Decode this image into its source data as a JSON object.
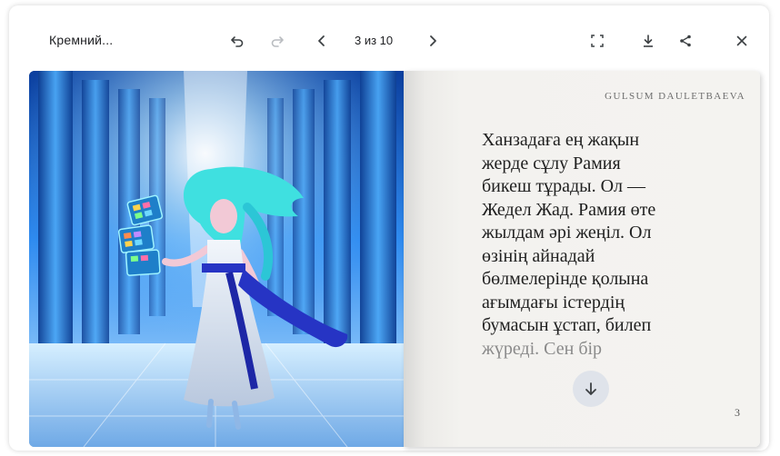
{
  "toolbar": {
    "title": "Кремний...",
    "page_indicator": "3 из 10",
    "icons": [
      "undo-icon",
      "redo-icon",
      "chevron-left-icon",
      "chevron-right-icon",
      "fullscreen-icon",
      "download-icon",
      "share-icon",
      "close-icon"
    ]
  },
  "book": {
    "author": "GULSUM DAULETBAEVA",
    "story_lines": [
      "Ханзадаға ең жақын",
      "жерде сұлу Рамия",
      "бикеш тұрады. Ол —",
      "Жедел Жад. Рамия өте",
      "жылдам әрі жеңіл. Ол",
      "өзінің айнадай",
      "бөлмелерінде қолына",
      "ағымдағы істердің",
      "бумасын ұстап, билеп",
      "жүреді. Сен бір"
    ],
    "page_number": "3"
  },
  "colors": {
    "accent": "#dfe3ea",
    "illustration_primary": "#1c5fc7",
    "illustration_hair": "#3fe0e0",
    "dress": "#e8edf5",
    "sash": "#2634c4"
  }
}
